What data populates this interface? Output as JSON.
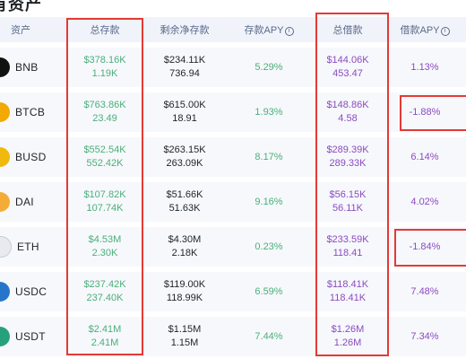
{
  "page": {
    "title": "有资产"
  },
  "headers": {
    "asset": "资产",
    "total_deposit": "总存款",
    "remaining_net_deposit": "剩余净存款",
    "deposit_apy": "存款APY",
    "total_borrow": "总借款",
    "borrow_apy": "借款APY",
    "info_glyph": "i"
  },
  "rows": [
    {
      "symbol": "BNB",
      "coin_color": "#111111",
      "deposit_usd": "$378.16K",
      "deposit_amt": "1.19K",
      "remaining_usd": "$234.11K",
      "remaining_amt": "736.94",
      "deposit_apy": "5.29%",
      "borrow_usd": "$144.06K",
      "borrow_amt": "453.47",
      "borrow_apy": "1.13%"
    },
    {
      "symbol": "BTCB",
      "coin_color": "#f2a900",
      "deposit_usd": "$763.86K",
      "deposit_amt": "23.49",
      "remaining_usd": "$615.00K",
      "remaining_amt": "18.91",
      "deposit_apy": "1.93%",
      "borrow_usd": "$148.86K",
      "borrow_amt": "4.58",
      "borrow_apy": "-1.88%"
    },
    {
      "symbol": "BUSD",
      "coin_color": "#f0b90b",
      "deposit_usd": "$552.54K",
      "deposit_amt": "552.42K",
      "remaining_usd": "$263.15K",
      "remaining_amt": "263.09K",
      "deposit_apy": "8.17%",
      "borrow_usd": "$289.39K",
      "borrow_amt": "289.33K",
      "borrow_apy": "6.14%"
    },
    {
      "symbol": "DAI",
      "coin_color": "#f5ac37",
      "deposit_usd": "$107.82K",
      "deposit_amt": "107.74K",
      "remaining_usd": "$51.66K",
      "remaining_amt": "51.63K",
      "deposit_apy": "9.16%",
      "borrow_usd": "$56.15K",
      "borrow_amt": "56.11K",
      "borrow_apy": "4.02%"
    },
    {
      "symbol": "ETH",
      "coin_color": "#e8eaf0",
      "deposit_usd": "$4.53M",
      "deposit_amt": "2.30K",
      "remaining_usd": "$4.30M",
      "remaining_amt": "2.18K",
      "deposit_apy": "0.23%",
      "borrow_usd": "$233.59K",
      "borrow_amt": "118.41",
      "borrow_apy": "-1.84%"
    },
    {
      "symbol": "USDC",
      "coin_color": "#2775ca",
      "deposit_usd": "$237.42K",
      "deposit_amt": "237.40K",
      "remaining_usd": "$119.00K",
      "remaining_amt": "118.99K",
      "deposit_apy": "6.59%",
      "borrow_usd": "$118.41K",
      "borrow_amt": "118.41K",
      "borrow_apy": "7.48%"
    },
    {
      "symbol": "USDT",
      "coin_color": "#26a17b",
      "deposit_usd": "$2.41M",
      "deposit_amt": "2.41M",
      "remaining_usd": "$1.15M",
      "remaining_amt": "1.15M",
      "deposit_apy": "7.44%",
      "borrow_usd": "$1.26M",
      "borrow_amt": "1.26M",
      "borrow_apy": "7.34%"
    }
  ],
  "highlight_color": "#e53935"
}
